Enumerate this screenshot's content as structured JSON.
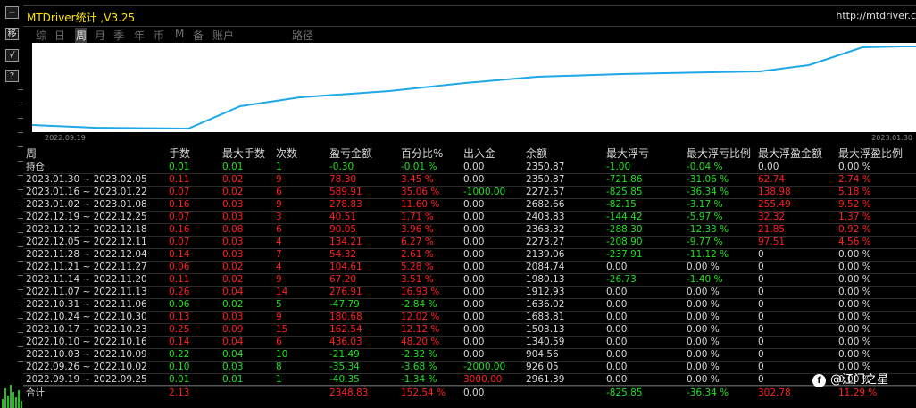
{
  "app": {
    "title": "MTDriver统计 ,V3.25",
    "url": "http://mtdriver.c"
  },
  "side_buttons": [
    "−",
    "移",
    "√",
    "?"
  ],
  "tabs": [
    {
      "label": "综",
      "active": false
    },
    {
      "label": "日",
      "active": false
    },
    {
      "label": "周",
      "active": true
    },
    {
      "label": "月",
      "active": false
    },
    {
      "label": "季",
      "active": false
    },
    {
      "label": "年",
      "active": false
    },
    {
      "label": "币",
      "active": false
    },
    {
      "label": "M",
      "active": false
    },
    {
      "label": "备",
      "active": false
    },
    {
      "label": "账户",
      "active": false
    },
    {
      "label": "路径",
      "active": false
    }
  ],
  "equity_chart": {
    "start_date": "2022.09.19",
    "end_date": "2023.01.30",
    "line_color": "#1ea8e8"
  },
  "colors": {
    "green": "#22e022",
    "red": "#ff2020",
    "white": "#d8d8d8",
    "header": "#d4d4d4"
  },
  "table": {
    "headers": [
      "周",
      "手数",
      "最大手数",
      "次数",
      "盈亏金额",
      "百分比%",
      "出入金",
      "余额",
      "最大浮亏",
      "最大浮亏比例",
      "最大浮盈金额",
      "最大浮盈比例"
    ],
    "rows": [
      [
        "持仓",
        "0.01",
        "0.01",
        "1",
        "-0.30",
        "-0.01 %",
        "0.00",
        "2350.87",
        "-1.00",
        "-0.04 %",
        "0.00",
        "0.00 %"
      ],
      [
        "2023.01.30 ~ 2023.02.05",
        "0.11",
        "0.02",
        "9",
        "78.30",
        "3.45 %",
        "0.00",
        "2350.87",
        "-721.86",
        "-31.06 %",
        "62.74",
        "2.74 %"
      ],
      [
        "2023.01.16 ~ 2023.01.22",
        "0.07",
        "0.02",
        "6",
        "589.91",
        "35.06 %",
        "-1000.00",
        "2272.57",
        "-825.85",
        "-36.34 %",
        "138.98",
        "5.18 %"
      ],
      [
        "2023.01.02 ~ 2023.01.08",
        "0.16",
        "0.03",
        "9",
        "278.83",
        "11.60 %",
        "0.00",
        "2682.66",
        "-82.15",
        "-3.17 %",
        "255.49",
        "9.52 %"
      ],
      [
        "2022.12.19 ~ 2022.12.25",
        "0.07",
        "0.03",
        "3",
        "40.51",
        "1.71 %",
        "0.00",
        "2403.83",
        "-144.42",
        "-5.97 %",
        "32.32",
        "1.37 %"
      ],
      [
        "2022.12.12 ~ 2022.12.18",
        "0.16",
        "0.08",
        "6",
        "90.05",
        "3.96 %",
        "0.00",
        "2363.32",
        "-288.30",
        "-12.33 %",
        "21.85",
        "0.92 %"
      ],
      [
        "2022.12.05 ~ 2022.12.11",
        "0.07",
        "0.03",
        "4",
        "134.21",
        "6.27 %",
        "0.00",
        "2273.27",
        "-208.90",
        "-9.77 %",
        "97.51",
        "4.56 %"
      ],
      [
        "2022.11.28 ~ 2022.12.04",
        "0.14",
        "0.03",
        "7",
        "54.32",
        "2.61 %",
        "0.00",
        "2139.06",
        "-237.91",
        "-11.12 %",
        "0",
        "0.00 %"
      ],
      [
        "2022.11.21 ~ 2022.11.27",
        "0.06",
        "0.02",
        "4",
        "104.61",
        "5.28 %",
        "0.00",
        "2084.74",
        "0.00",
        "0.00 %",
        "0",
        "0.00 %"
      ],
      [
        "2022.11.14 ~ 2022.11.20",
        "0.11",
        "0.02",
        "9",
        "67.20",
        "3.51 %",
        "0.00",
        "1980.13",
        "-26.73",
        "-1.40 %",
        "0",
        "0.00 %"
      ],
      [
        "2022.11.07 ~ 2022.11.13",
        "0.26",
        "0.04",
        "14",
        "276.91",
        "16.93 %",
        "0.00",
        "1912.93",
        "0.00",
        "0.00 %",
        "0",
        "0.00 %"
      ],
      [
        "2022.10.31 ~ 2022.11.06",
        "0.06",
        "0.02",
        "5",
        "-47.79",
        "-2.84 %",
        "0.00",
        "1636.02",
        "0.00",
        "0.00 %",
        "0",
        "0.00 %"
      ],
      [
        "2022.10.24 ~ 2022.10.30",
        "0.13",
        "0.03",
        "9",
        "180.68",
        "12.02 %",
        "0.00",
        "1683.81",
        "0.00",
        "0.00 %",
        "0",
        "0.00 %"
      ],
      [
        "2022.10.17 ~ 2022.10.23",
        "0.25",
        "0.09",
        "15",
        "162.54",
        "12.12 %",
        "0.00",
        "1503.13",
        "0.00",
        "0.00 %",
        "0",
        "0.00 %"
      ],
      [
        "2022.10.10 ~ 2022.10.16",
        "0.14",
        "0.04",
        "6",
        "436.03",
        "48.20 %",
        "0.00",
        "1340.59",
        "0.00",
        "0.00 %",
        "0",
        "0.00 %"
      ],
      [
        "2022.10.03 ~ 2022.10.09",
        "0.22",
        "0.04",
        "10",
        "-21.49",
        "-2.32 %",
        "0.00",
        "904.56",
        "0.00",
        "0.00 %",
        "0",
        "0.00 %"
      ],
      [
        "2022.09.26 ~ 2022.10.02",
        "0.10",
        "0.03",
        "8",
        "-35.34",
        "-3.68 %",
        "-2000.00",
        "926.05",
        "0.00",
        "0.00 %",
        "0",
        "0.00 %"
      ],
      [
        "2022.09.19 ~ 2022.09.25",
        "0.01",
        "0.01",
        "1",
        "-40.35",
        "-1.34 %",
        "3000.00",
        "2961.39",
        "0.00",
        "0.00 %",
        "0",
        "0.00 %"
      ]
    ],
    "row_colors": [
      "green",
      "red",
      "red",
      "red",
      "red",
      "red",
      "red",
      "red",
      "red",
      "red",
      "red",
      "green",
      "red",
      "red",
      "red",
      "green",
      "green",
      "green"
    ],
    "total": [
      "合计",
      "2.13",
      "",
      "",
      "2348.83",
      "152.54 %",
      "0.00",
      "",
      "-825.85",
      "-36.34 %",
      "302.78",
      "11.29 %"
    ]
  },
  "watermark": {
    "icon": "f",
    "text": "@江门之星"
  }
}
